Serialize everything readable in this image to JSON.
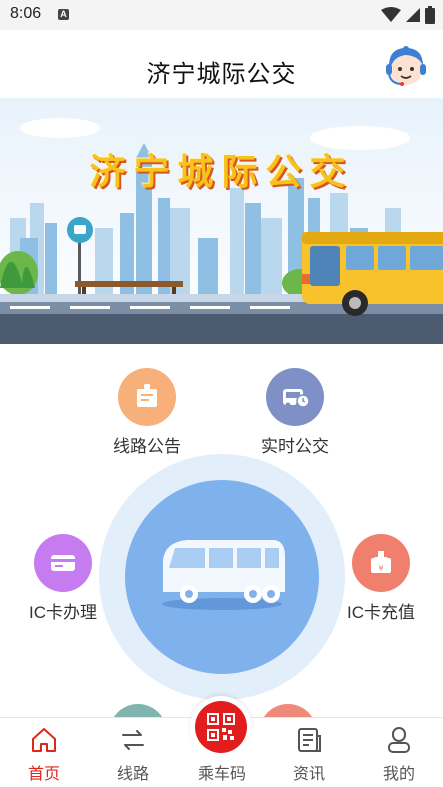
{
  "status_bar": {
    "time": "8:06",
    "notification_icon": "a-app-icon"
  },
  "header": {
    "title": "济宁城际公交",
    "support_icon": "customer-service-icon"
  },
  "banner": {
    "title": "济宁城际公交"
  },
  "features": {
    "route_notice": {
      "label": "线路公告",
      "color": "#f7b07a",
      "icon": "notice-board-icon"
    },
    "realtime_bus": {
      "label": "实时公交",
      "color": "#7f90c7",
      "icon": "bus-clock-icon"
    },
    "ic_card_apply": {
      "label": "IC卡办理",
      "color": "#c77bf0",
      "icon": "card-icon"
    },
    "ic_card_recharge": {
      "label": "IC卡充值",
      "color": "#f0806d",
      "icon": "yen-download-icon"
    }
  },
  "bottom_nav": {
    "home": {
      "label": "首页",
      "active": true
    },
    "routes": {
      "label": "线路"
    },
    "ride_code": {
      "label": "乘车码"
    },
    "news": {
      "label": "资讯"
    },
    "mine": {
      "label": "我的"
    }
  },
  "colors": {
    "accent": "#e0251b",
    "hub_outer": "#e3eefb",
    "hub_inner": "#7fb2ec"
  }
}
